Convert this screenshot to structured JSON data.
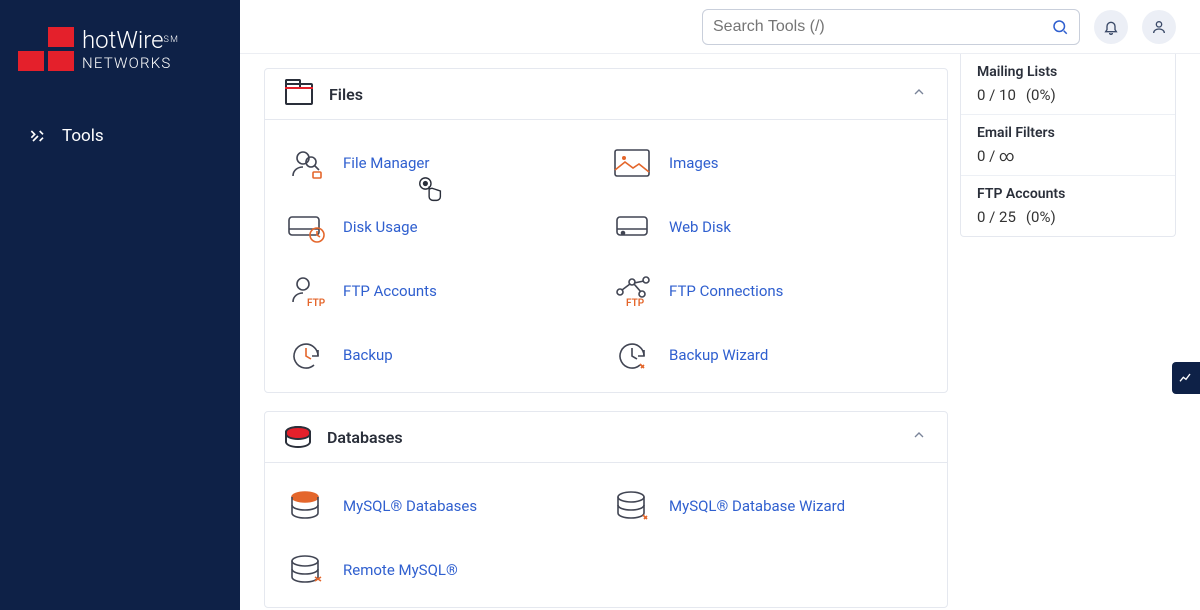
{
  "brand": {
    "name": "hotWire",
    "sub": "NETWORKS",
    "mark": "SM"
  },
  "sidebar": {
    "tools": "Tools"
  },
  "search": {
    "placeholder": "Search Tools (/)"
  },
  "panels": {
    "files": {
      "title": "Files",
      "items": [
        {
          "label": "File Manager",
          "icon": "user-lens"
        },
        {
          "label": "Images",
          "icon": "image"
        },
        {
          "label": "Disk Usage",
          "icon": "disk-clock"
        },
        {
          "label": "Web Disk",
          "icon": "disk"
        },
        {
          "label": "FTP Accounts",
          "icon": "ftp-user"
        },
        {
          "label": "FTP Connections",
          "icon": "ftp-nodes"
        },
        {
          "label": "Backup",
          "icon": "backup"
        },
        {
          "label": "Backup Wizard",
          "icon": "backup-wiz"
        }
      ]
    },
    "databases": {
      "title": "Databases",
      "items": [
        {
          "label": "MySQL® Databases",
          "icon": "db"
        },
        {
          "label": "MySQL® Database Wizard",
          "icon": "db-wiz"
        },
        {
          "label": "Remote MySQL®",
          "icon": "db-remote"
        }
      ]
    }
  },
  "stats": [
    {
      "title": "Mailing Lists",
      "v": "0 / 10",
      "pct": "(0%)"
    },
    {
      "title": "Email Filters",
      "v": "0 / ∞",
      "pct": ""
    },
    {
      "title": "FTP Accounts",
      "v": "0 / 25",
      "pct": "(0%)"
    }
  ]
}
